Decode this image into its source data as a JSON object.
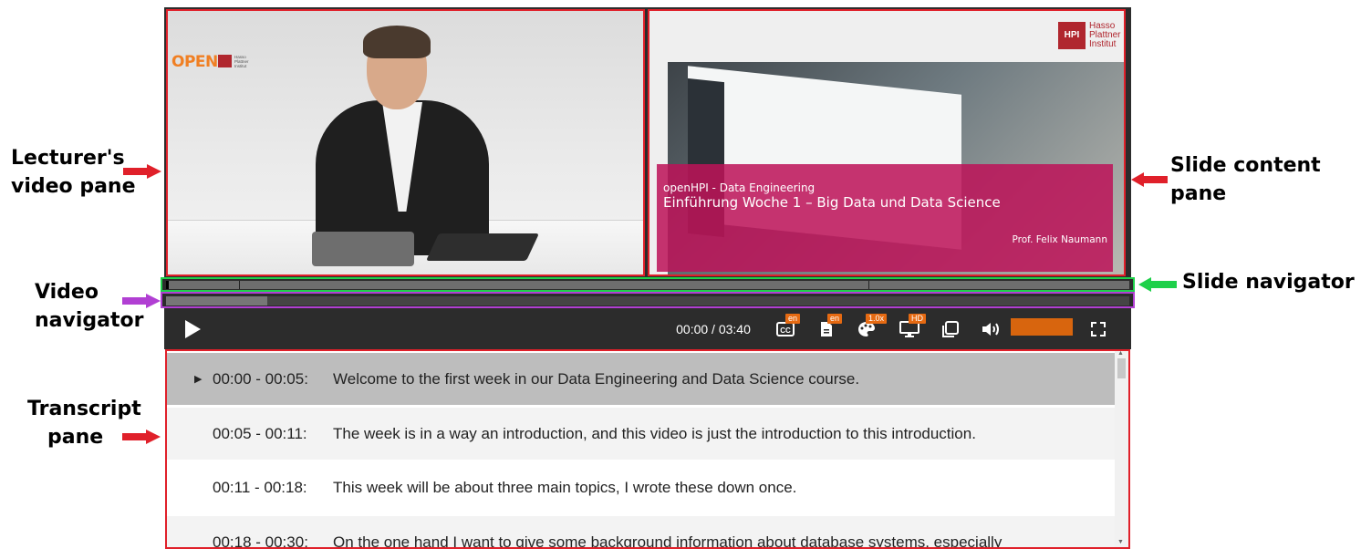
{
  "annotations": {
    "lecturer_pane": [
      "Lecturer's",
      "video pane"
    ],
    "slide_content_pane": [
      "Slide content",
      "pane"
    ],
    "slide_navigator": "Slide navigator",
    "video_navigator": [
      "Video",
      "navigator"
    ],
    "transcript_pane": [
      "Transcript",
      "pane"
    ]
  },
  "lecturer": {
    "logo_text": "OPEN",
    "logo_small": [
      "Hasso",
      "Plattner",
      "Institut"
    ]
  },
  "slide": {
    "hpi_mark": "HPI",
    "institute": [
      "Hasso",
      "Plattner",
      "Institut"
    ],
    "subtitle": "openHPI - Data Engineering",
    "title": "Einführung Woche 1 – Big Data und Data Science",
    "author": "Prof. Felix Naumann"
  },
  "player": {
    "time": "00:00 / 03:40",
    "cc_badge": "en",
    "transcript_badge": "en",
    "speed_badge": "1.0x",
    "quality_badge": "HD",
    "playback_progress": 0.0,
    "buffered_fraction": 0.105,
    "volume_level": 1.0
  },
  "transcript": [
    {
      "time": "00:00 - 00:05:",
      "text": "Welcome to the first week in our Data Engineering and Data Science course.",
      "active": true
    },
    {
      "time": "00:05 - 00:11:",
      "text": "The week is in a way an introduction, and this video is just the introduction to this introduction.",
      "active": false
    },
    {
      "time": "00:11 - 00:18:",
      "text": "This week will be about three main topics, I wrote these down once.",
      "active": false
    },
    {
      "time": "00:18 - 00:30:",
      "text": "On the one hand I want to give some background information about database systems, especially",
      "active": false
    }
  ],
  "colors": {
    "accent": "#e66a12",
    "slide_band": "#bd1359",
    "highlight_red": "#e0202a",
    "highlight_green": "#1ed04a",
    "highlight_purple": "#b13fd3"
  }
}
